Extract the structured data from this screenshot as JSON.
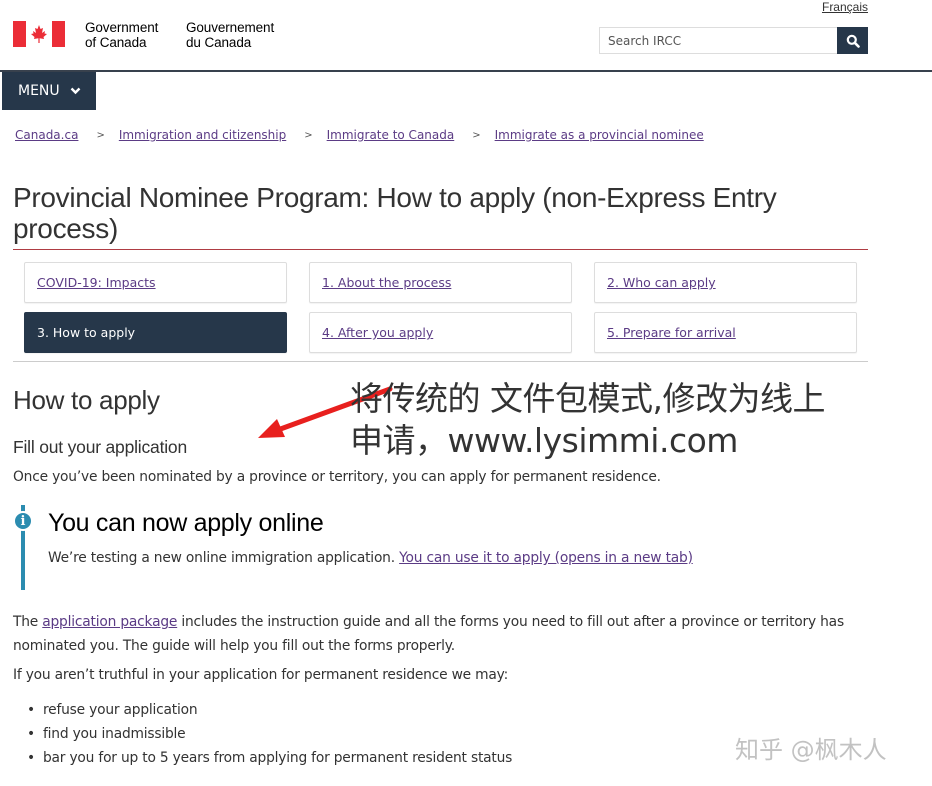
{
  "header": {
    "signature_en_line1": "Government",
    "signature_en_line2": "of Canada",
    "signature_fr_line1": "Gouvernement",
    "signature_fr_line2": "du Canada",
    "language_link": "Français",
    "search_placeholder": "Search IRCC",
    "search_icon": "magnifier-icon",
    "menu_label": "MENU",
    "menu_icon": "chevron-down-icon"
  },
  "colors": {
    "brand_navy": "#26374a",
    "flag_red": "#eb2d37",
    "link_purple": "#5b3b85",
    "title_rule": "#af3c43",
    "alert_blue": "#2b8cb0",
    "annotation_arrow": "#e8201e"
  },
  "breadcrumb": [
    {
      "label": "Canada.ca"
    },
    {
      "label": "Immigration and citizenship"
    },
    {
      "label": "Immigrate to Canada"
    },
    {
      "label": "Immigrate as a provincial nominee"
    }
  ],
  "page_title": "Provincial Nominee Program: How to apply (non-Express Entry process)",
  "steps": [
    {
      "label": "COVID-19: Impacts",
      "active": false
    },
    {
      "label": "1. About the process",
      "active": false
    },
    {
      "label": "2. Who can apply",
      "active": false
    },
    {
      "label": "3. How to apply",
      "active": true
    },
    {
      "label": "4. After you apply",
      "active": false
    },
    {
      "label": "5. Prepare for arrival",
      "active": false
    }
  ],
  "section": {
    "heading": "How to apply",
    "subheading": "Fill out your application",
    "intro": "Once you’ve been nominated by a province or territory, you can apply for permanent residence."
  },
  "alert": {
    "icon": "info-icon",
    "title": "You can now apply online",
    "text": "We’re testing a new online immigration application. ",
    "link": "You can use it to apply (opens in a new tab)"
  },
  "package_paragraph": {
    "before": "The ",
    "link": "application package",
    "after": " includes the instruction guide and all the forms you need to fill out after a province or territory has nominated you. The guide will help you fill out the forms properly."
  },
  "truthful_paragraph": "If you aren’t truthful in your application for permanent residence we may:",
  "consequences": [
    "refuse your application",
    "find you inadmissible",
    "bar you for up to 5 years from applying for permanent resident status"
  ],
  "annotation": {
    "line1": "将传统的 文件包模式,修改为线上",
    "line2": "申请，www.lysimmi.com"
  },
  "watermark": "知乎 @枫木人"
}
